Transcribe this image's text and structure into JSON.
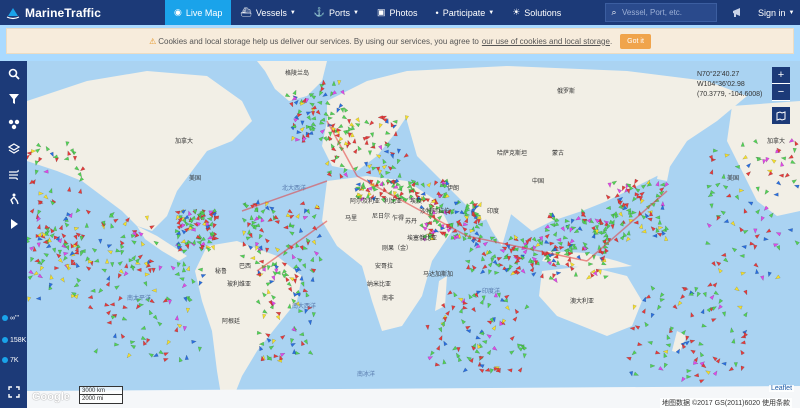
{
  "brand": {
    "name": "MarineTraffic"
  },
  "nav": {
    "items": [
      {
        "label": "Live Map",
        "icon": "map-pin-icon",
        "active": true,
        "caret": false
      },
      {
        "label": "Vessels",
        "icon": "ship-icon",
        "active": false,
        "caret": true
      },
      {
        "label": "Ports",
        "icon": "anchor-icon",
        "active": false,
        "caret": true
      },
      {
        "label": "Photos",
        "icon": "camera-icon",
        "active": false,
        "caret": false
      },
      {
        "label": "Participate",
        "icon": "antenna-icon",
        "active": false,
        "caret": true
      },
      {
        "label": "Solutions",
        "icon": "bulb-icon",
        "active": false,
        "caret": false
      }
    ],
    "search_placeholder": "Vessel, Port, etc.",
    "signin_label": "Sign in"
  },
  "cookie_banner": {
    "text": "Cookies and local storage help us deliver our services. By using our services, you agree to",
    "link_text": "our use of cookies and local storage",
    "suffix": ".",
    "button_label": "Got it"
  },
  "sidebar": {
    "buttons": [
      "search-icon",
      "filter-icon",
      "layers-shapes-icon",
      "stack-icon",
      "wind-icon",
      "route-icon",
      "play-icon"
    ],
    "stats": [
      {
        "label": "∞'''",
        "color": "#1aa3ea"
      },
      {
        "label": "158K",
        "color": "#1aa3ea"
      },
      {
        "label": "7K",
        "color": "#1aa3ea"
      }
    ]
  },
  "map": {
    "coordinates": {
      "lat": "N70°22'40.27",
      "lon": "W104°36'02.98",
      "decimal": "(70.3779, -104.6008)"
    },
    "zoom_in": "+",
    "zoom_out": "−",
    "scale_km": "3000 km",
    "scale_mi": "2000 mi",
    "google": "Google",
    "leaflet": "Leaflet",
    "attribution": "地图数据 ©2017 GS(2011)6020  使用条款",
    "labels": {
      "greenland": "格陵兰岛",
      "russia": "俄罗斯",
      "canada_l": "加拿大",
      "canada_r": "加拿大",
      "usa_l": "美国",
      "usa_r": "美国",
      "kazakh": "哈萨克斯坦",
      "mongolia": "蒙古",
      "china": "中国",
      "india": "印度",
      "saudi": "沙特阿拉伯",
      "libya": "利比亚",
      "egypt": "埃及",
      "algeria": "阿尔及利亚",
      "mali": "马里",
      "niger": "尼日尔",
      "chad": "乍得",
      "sudan": "苏丹",
      "ethiopia": "埃塞俄比亚",
      "drc": "刚果（金）",
      "angola": "安哥拉",
      "namibia": "纳米比亚",
      "southafrica": "南非",
      "madagascar": "马达加斯加",
      "brazil": "巴西",
      "peru": "秘鲁",
      "bolivia": "玻利维亚",
      "argentina": "阿根廷",
      "australia": "澳大利亚",
      "iran": "伊朗",
      "atlantic_n": "北大西洋",
      "atlantic_s": "南大西洋",
      "indian": "印度洋",
      "pacific_s": "南太平洋",
      "antarctic": "南冰洋"
    }
  },
  "colors": {
    "nav_bg": "#1c3a78",
    "accent": "#1aa3ea",
    "ocean": "#aad3f2",
    "land": "#f2efe6",
    "cargo": "#52d156",
    "tanker": "#e43c3c",
    "passenger": "#2b6fde",
    "highspeed": "#f5df2c",
    "other": "#e049e6"
  }
}
